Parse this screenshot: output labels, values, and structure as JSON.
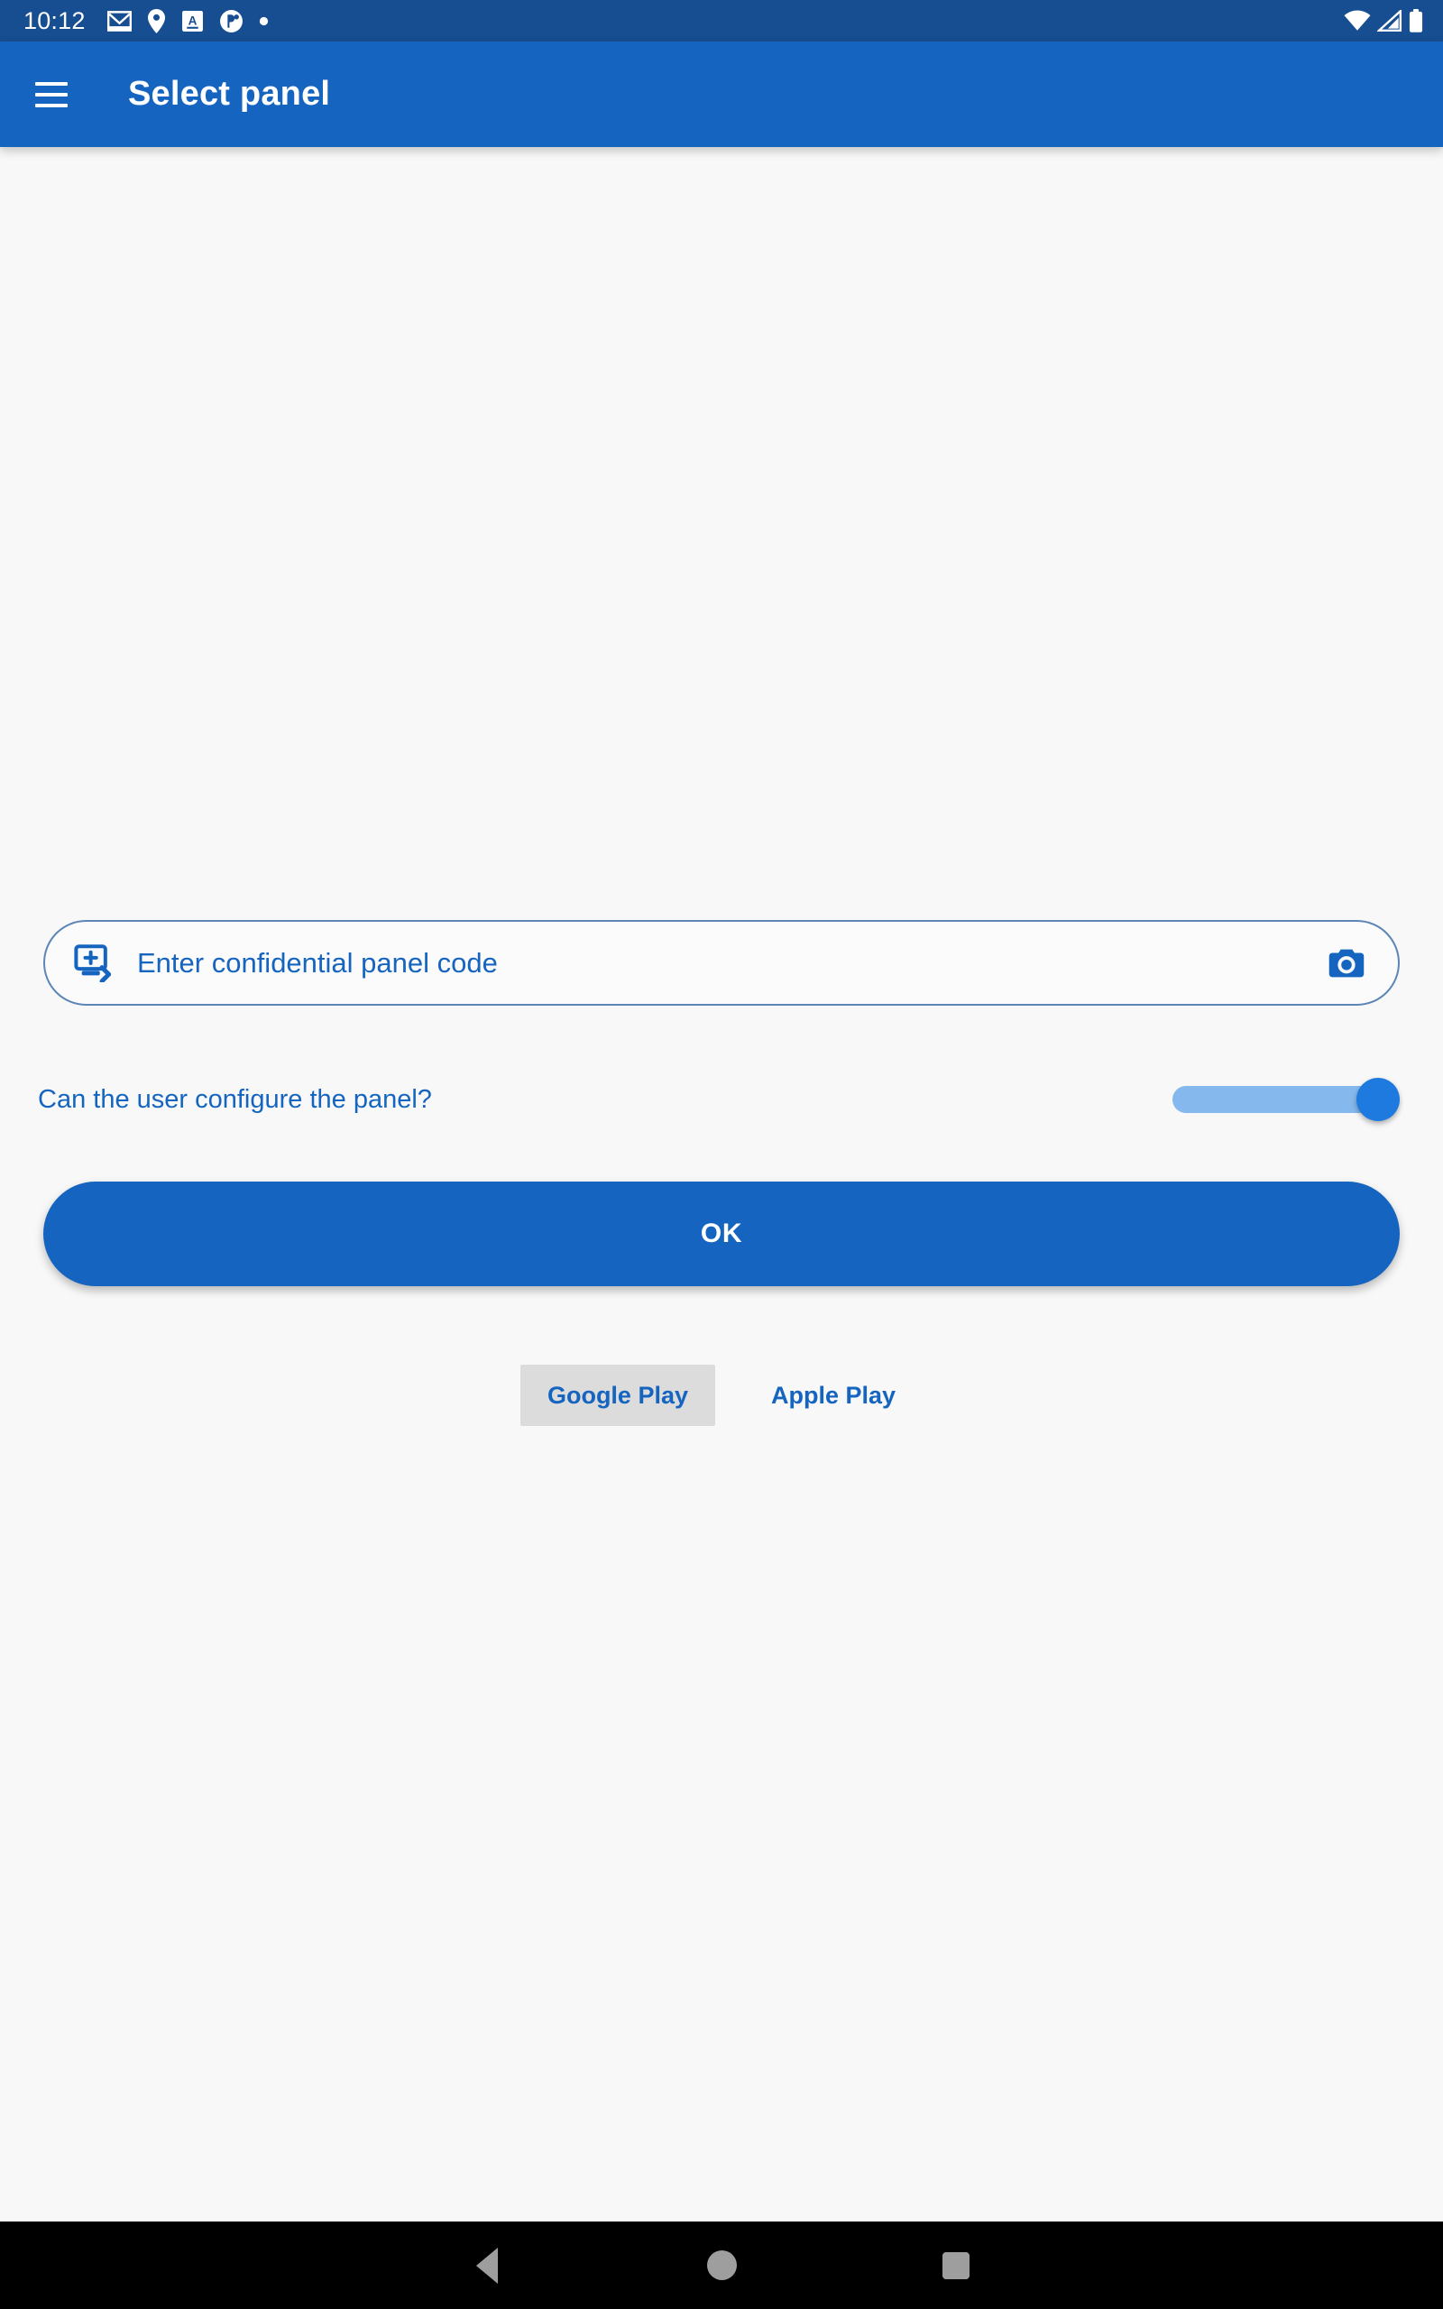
{
  "status_bar": {
    "clock": "10:12",
    "background_color": "#174E91",
    "left_icons": [
      {
        "name": "gmail-icon"
      },
      {
        "name": "location-pin-icon"
      },
      {
        "name": "translate-a-icon"
      },
      {
        "name": "circle-badge-icon"
      },
      {
        "name": "dot-icon"
      }
    ],
    "right_icons": [
      {
        "name": "wifi-icon"
      },
      {
        "name": "cellular-signal-icon"
      },
      {
        "name": "battery-icon"
      }
    ]
  },
  "app_bar": {
    "title": "Select panel",
    "menu_icon": "hamburger-menu-icon",
    "background_color": "#1565C0"
  },
  "form": {
    "code_field": {
      "placeholder": "Enter confidential panel code",
      "value": "",
      "leading_icon": "add-to-screen-icon",
      "trailing_icon": "camera-icon",
      "border_color": "#5B86B5",
      "text_color": "#1565C0"
    },
    "configure_toggle": {
      "label": "Can the user configure the panel?",
      "state": "on",
      "track_color": "#85B8EC",
      "thumb_color": "#1F7AE0"
    },
    "submit_button": {
      "label": "OK",
      "background_color": "#1565C0",
      "text_color": "#FFFFFF"
    }
  },
  "store_tabs": {
    "selected_index": 0,
    "items": [
      {
        "label": "Google Play",
        "selected": true
      },
      {
        "label": "Apple Play",
        "selected": false
      }
    ],
    "selected_background": "#DCDCDC",
    "text_color": "#1565C0"
  },
  "nav_bar": {
    "background_color": "#000000",
    "buttons": [
      {
        "name": "back-button",
        "icon": "triangle-left-icon"
      },
      {
        "name": "home-button",
        "icon": "circle-icon"
      },
      {
        "name": "recents-button",
        "icon": "square-icon"
      }
    ]
  },
  "page": {
    "background_color": "#F8F8F8"
  }
}
